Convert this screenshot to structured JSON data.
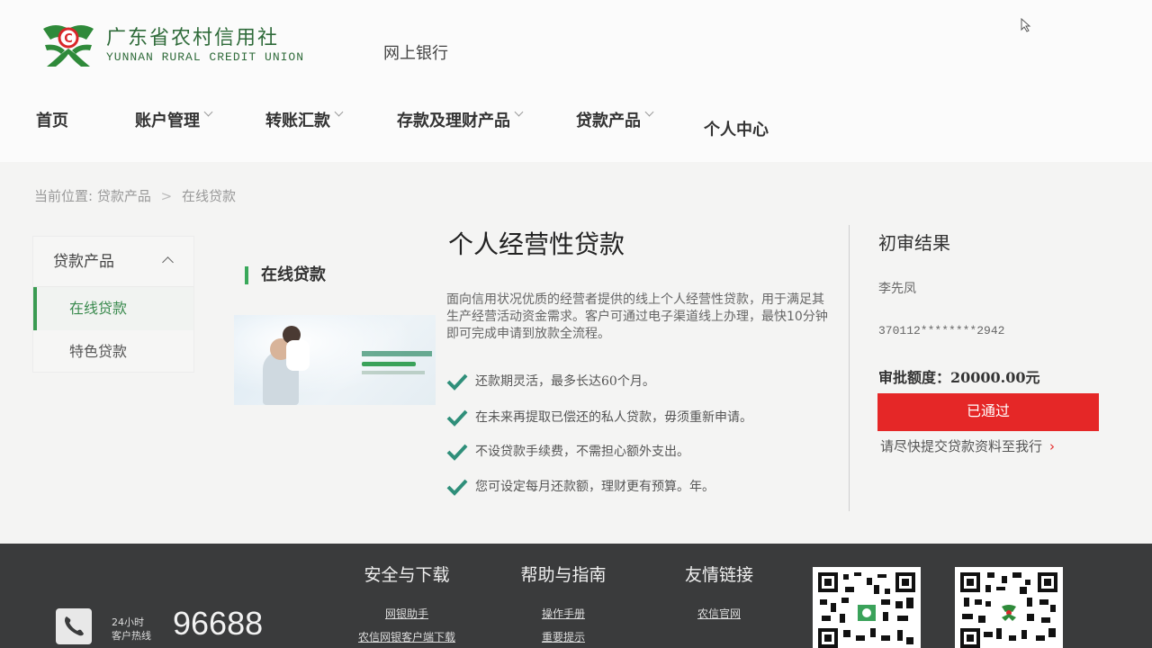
{
  "brand": {
    "name_cn": "广东省农村信用社",
    "name_en": "YUNNAN RURAL CREDIT UNION",
    "color": "#2f6b3a",
    "logo_icon": "rural-credit-logo-icon"
  },
  "header": {
    "ebank_label": "网上银行"
  },
  "nav": {
    "items": [
      {
        "label": "首页",
        "has_dropdown": false
      },
      {
        "label": "账户管理",
        "has_dropdown": true
      },
      {
        "label": "转账汇款",
        "has_dropdown": true
      },
      {
        "label": "存款及理财产品",
        "has_dropdown": true
      },
      {
        "label": "贷款产品",
        "has_dropdown": true
      },
      {
        "label": "个人中心",
        "has_dropdown": false
      }
    ]
  },
  "breadcrumb": {
    "prefix": "当前位置:",
    "level1": "贷款产品",
    "separator": ">",
    "current": "在线贷款"
  },
  "sidebar": {
    "title": "贷款产品",
    "items": [
      {
        "label": "在线贷款",
        "active": true
      },
      {
        "label": "特色贷款",
        "active": false
      }
    ]
  },
  "section": {
    "title": "在线贷款",
    "accent": "#39a85a"
  },
  "product": {
    "title": "个人经营性贷款",
    "description": "面向信用状况优质的经营者提供的线上个人经营性贷款，用于满足其生产经营活动资金需求。客户可通过电子渠道线上办理，最快10分钟即可完成申请到放款全流程。",
    "features": [
      "还款期灵活，最多长达60个月。",
      "在未来再提取已偿还的私人贷款，毋须重新申请。",
      "不设贷款手续费，不需担心额外支出。",
      "您可设定每月还款额，理财更有预算。年。"
    ],
    "check_color": "#2f8f7a"
  },
  "result": {
    "title": "初审结果",
    "name": "李先凤",
    "id_number": "370112********2942",
    "amount_text": "审批额度：20000.00元",
    "status_label": "已通过",
    "status_color": "#e52727",
    "link_text": "请尽快提交贷款资料至我行",
    "link_arrow": "›"
  },
  "footer": {
    "hotline_label_1": "24小时",
    "hotline_label_2": "客户热线",
    "hotline_number": "96688",
    "columns": [
      {
        "title": "安全与下载",
        "links": [
          "网银助手",
          "农信网银客户端下载"
        ]
      },
      {
        "title": "帮助与指南",
        "links": [
          "操作手册",
          "重要提示"
        ]
      },
      {
        "title": "友情链接",
        "links": [
          "农信官网"
        ]
      }
    ],
    "bg_color": "#3a3b3c"
  }
}
